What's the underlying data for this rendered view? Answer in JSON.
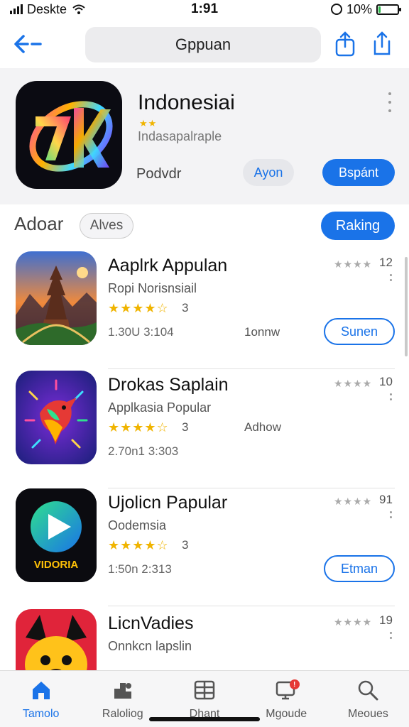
{
  "status_bar": {
    "carrier": "Deskte",
    "time": "1:91",
    "battery": "10%",
    "battery_level": 0.1
  },
  "topbar": {
    "search_title": "Gppuan"
  },
  "hero": {
    "title": "Indonesiai",
    "stars": "★★",
    "subtitle": "Indasapalraple",
    "label": "Podvdr",
    "secondary_button": "Ayon",
    "primary_button": "Bspánt"
  },
  "section": {
    "title": "Adoar",
    "chip": "Alves",
    "button": "Raking"
  },
  "apps": [
    {
      "name": "Aaplrk Appulan",
      "subtitle": "Ropi Norisnsiail",
      "stars": "★★★★☆",
      "rating_count": "3",
      "meta": "1.30U 3:104",
      "extra": "1onnw",
      "right_stars": "★★★★",
      "right_num": "12",
      "button": "Sunen"
    },
    {
      "name": "Drokas Saplain",
      "subtitle": "Applkasia Popular",
      "stars": "★★★★☆",
      "rating_count": "3",
      "meta": "2.70n1 3:303",
      "extra": "Adhow",
      "right_stars": "★★★★",
      "right_num": "10",
      "button": ""
    },
    {
      "name": "Ujolicn Papular",
      "subtitle": "Oodemsia",
      "stars": "★★★★☆",
      "rating_count": "3",
      "meta": "1:50n 2:313",
      "extra": "",
      "right_stars": "★★★★",
      "right_num": "91",
      "button": "Etman",
      "icon_text": "VIDORIA"
    },
    {
      "name": "LicnVadies",
      "subtitle": "Onnkcn lapslin",
      "stars": "",
      "rating_count": "",
      "meta": "",
      "extra": "",
      "right_stars": "★★★★",
      "right_num": "19",
      "button": ""
    }
  ],
  "tabs": [
    {
      "label": "Tamolo",
      "icon": "home-icon"
    },
    {
      "label": "Raloliog",
      "icon": "ranking-icon"
    },
    {
      "label": "Dhant",
      "icon": "apps-icon"
    },
    {
      "label": "Mgoude",
      "icon": "updates-icon",
      "badge": "!"
    },
    {
      "label": "Meoues",
      "icon": "search-icon"
    }
  ],
  "colors": {
    "accent": "#1a73e8",
    "star": "#f0b400",
    "badge": "#e53935",
    "battery": "#2db84a"
  }
}
